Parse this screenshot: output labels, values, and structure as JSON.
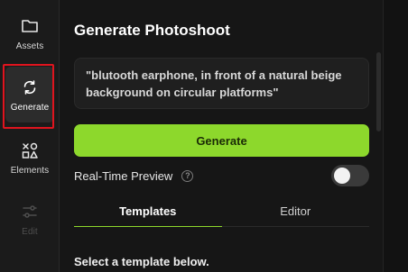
{
  "sidebar": {
    "items": [
      {
        "label": "Assets",
        "icon": "folder-icon",
        "state": "normal"
      },
      {
        "label": "Generate",
        "icon": "refresh-icon",
        "state": "active"
      },
      {
        "label": "Elements",
        "icon": "shapes-icon",
        "state": "normal"
      },
      {
        "label": "Edit",
        "icon": "sliders-icon",
        "state": "disabled"
      }
    ]
  },
  "panel": {
    "title": "Generate Photoshoot",
    "prompt_text": "\"blutooth earphone, in front of a natural beige background on circular platforms\"",
    "generate_label": "Generate",
    "realtime_label": "Real-Time Preview",
    "help_glyph": "?",
    "realtime_enabled": false,
    "tabs": [
      {
        "label": "Templates",
        "active": true
      },
      {
        "label": "Editor",
        "active": false
      }
    ],
    "subheading": "Select a template below."
  },
  "colors": {
    "accent": "#8dd82c",
    "highlight": "#e0141e",
    "background": "#161616"
  }
}
